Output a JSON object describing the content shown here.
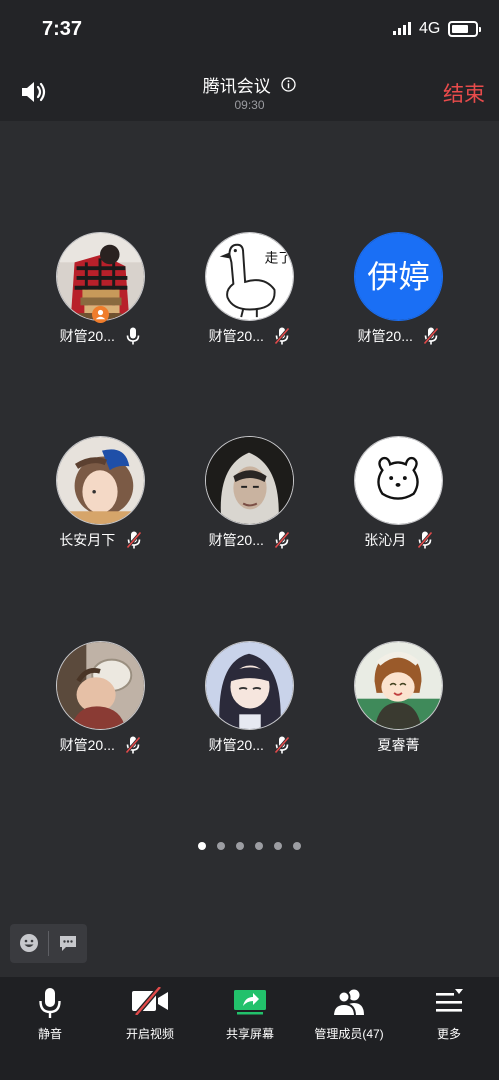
{
  "status_bar": {
    "time": "7:37",
    "network": "4G"
  },
  "header": {
    "title": "腾讯会议",
    "duration": "09:30",
    "end_label": "结束"
  },
  "participants": [
    {
      "name": "财管20...",
      "mic": "on",
      "avatar": "photo-reading-books",
      "host": true
    },
    {
      "name": "财管20...",
      "mic": "muted",
      "avatar": "goose-drawing",
      "avatar_text": "走了"
    },
    {
      "name": "财管20...",
      "mic": "muted",
      "avatar": "initials",
      "avatar_text": "伊婷",
      "avatar_color": "#1a6ff5"
    },
    {
      "name": "长安月下",
      "mic": "muted",
      "avatar": "girl-blue-bow"
    },
    {
      "name": "财管20...",
      "mic": "muted",
      "avatar": "person-white-hood"
    },
    {
      "name": "张沁月",
      "mic": "muted",
      "avatar": "bear-doodle"
    },
    {
      "name": "财管20...",
      "mic": "muted",
      "avatar": "baby-with-plate"
    },
    {
      "name": "财管20...",
      "mic": "muted",
      "avatar": "anime-girl-dark-hair"
    },
    {
      "name": "夏睿菁",
      "mic": "none",
      "avatar": "anime-girl-brown-hair"
    }
  ],
  "pagination": {
    "pages": 6,
    "current": 1
  },
  "toolbar": [
    {
      "label": "静音",
      "icon": "microphone-icon"
    },
    {
      "label": "开启视频",
      "icon": "video-off-icon"
    },
    {
      "label": "共享屏幕",
      "icon": "share-screen-icon"
    },
    {
      "label": "管理成员(47)",
      "icon": "members-icon"
    },
    {
      "label": "更多",
      "icon": "more-menu-icon"
    }
  ],
  "colors": {
    "background": "#2c2d30",
    "end_red": "#e84b4b",
    "share_green": "#22c16b",
    "host_orange": "#f07d2c",
    "muted_red": "#e24a4a"
  }
}
